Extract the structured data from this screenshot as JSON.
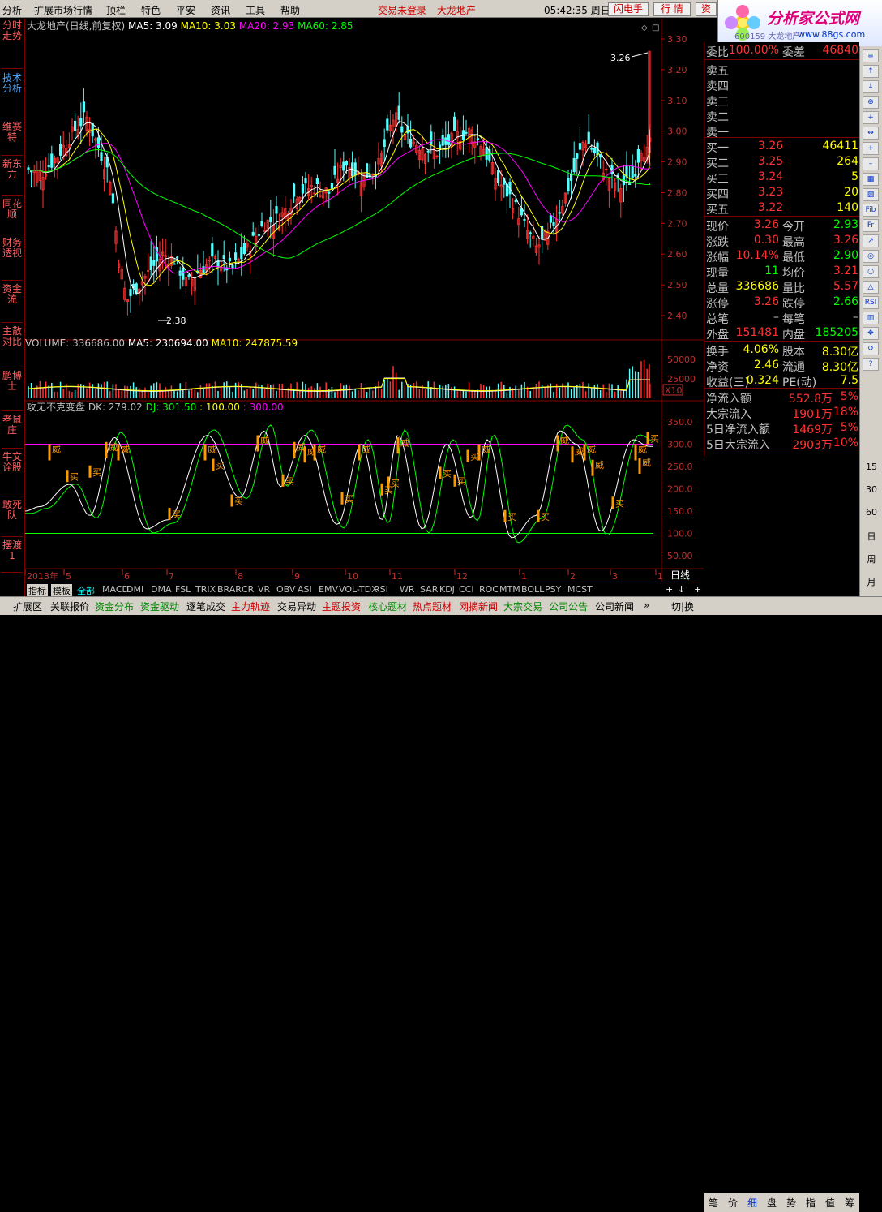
{
  "menu": {
    "items": [
      "分析",
      "扩展市场行情",
      "顶栏",
      "特色",
      "平安",
      "资讯",
      "工具",
      "帮助"
    ],
    "status_login": "交易未登录",
    "stock_name": "大龙地产",
    "clock": "05:42:35 周日",
    "btn_flash": "闪电手",
    "btn_quote": "行 情",
    "btn_zi": "资"
  },
  "logo": {
    "text": "分析家公式网",
    "url": "www.88gs.com",
    "code": "600159 大龙地产"
  },
  "leftbar": [
    "分时走势",
    "技术分析",
    "维赛特",
    "新东方",
    "同花顺",
    "财务透视",
    "资金流",
    "主散对比",
    "鹏博士",
    "老鼠庄",
    "牛文诠股",
    "敢死队",
    "摆渡1"
  ],
  "chart": {
    "title": "大龙地产(日线,前复权)",
    "ma5": "MA5: 3.09",
    "ma10": "MA10: 3.03",
    "ma20": "MA20: 2.93",
    "ma60": "MA60: 2.85",
    "price_ticks": [
      "3.30",
      "3.20",
      "3.10",
      "3.00",
      "2.90",
      "2.80",
      "2.70",
      "2.60",
      "2.50",
      "2.40"
    ],
    "high_label": "3.26",
    "low_label": "2.38",
    "vol_header": "VOLUME: 336686.00",
    "vol_ma5": "MA5: 230694.00",
    "vol_ma10": "MA10: 247875.59",
    "vol_ticks": [
      "50000",
      "25000"
    ],
    "vol_unit": "X10",
    "ind_title": "攻无不克变盘",
    "ind_dk": "DK: 279.02",
    "ind_dj": "DJ: 301.50",
    "ind_100": ": 100.00",
    "ind_300": ": 300.00",
    "ind_ticks": [
      "350.0",
      "300.0",
      "250.0",
      "200.0",
      "150.0",
      "100.0",
      "50.00"
    ],
    "sell_label": "威",
    "buy_label": "买",
    "date_labels": [
      "2013年",
      "5",
      "6",
      "7",
      "8",
      "9",
      "10",
      "11",
      "12",
      "1",
      "2",
      "3",
      "1"
    ],
    "period": "日线",
    "colors": {
      "up": "#ff3333",
      "down": "#54ffff",
      "ma5": "#ffffff",
      "ma10": "#ffff00",
      "ma20": "#ff00ff",
      "ma60": "#00ff00",
      "dk": "#ffffff",
      "dj": "#00ff00",
      "line300": "#ff00ff",
      "line100": "#00ff00",
      "signal": "#ff9900"
    }
  },
  "quote": {
    "weibi": {
      "l": "委比",
      "v": "100.00%",
      "l2": "委差",
      "v2": "46840"
    },
    "sell": [
      {
        "l": "卖五",
        "p": "",
        "v": ""
      },
      {
        "l": "卖四",
        "p": "",
        "v": ""
      },
      {
        "l": "卖三",
        "p": "",
        "v": ""
      },
      {
        "l": "卖二",
        "p": "",
        "v": ""
      },
      {
        "l": "卖一",
        "p": "",
        "v": ""
      }
    ],
    "buy": [
      {
        "l": "买一",
        "p": "3.26",
        "v": "46411"
      },
      {
        "l": "买二",
        "p": "3.25",
        "v": "264"
      },
      {
        "l": "买三",
        "p": "3.24",
        "v": "5"
      },
      {
        "l": "买四",
        "p": "3.23",
        "v": "20"
      },
      {
        "l": "买五",
        "p": "3.22",
        "v": "140"
      }
    ],
    "stats": [
      {
        "l": "现价",
        "v": "3.26",
        "vc": "#ff3333",
        "l2": "今开",
        "v2": "2.93",
        "v2c": "#00ff00"
      },
      {
        "l": "涨跌",
        "v": "0.30",
        "vc": "#ff3333",
        "l2": "最高",
        "v2": "3.26",
        "v2c": "#ff3333"
      },
      {
        "l": "涨幅",
        "v": "10.14%",
        "vc": "#ff3333",
        "l2": "最低",
        "v2": "2.90",
        "v2c": "#00ff00"
      },
      {
        "l": "现量",
        "v": "11",
        "vc": "#00ff00",
        "l2": "均价",
        "v2": "3.21",
        "v2c": "#ff3333"
      },
      {
        "l": "总量",
        "v": "336686",
        "vc": "#ffff00",
        "l2": "量比",
        "v2": "5.57",
        "v2c": "#ff3333"
      },
      {
        "l": "涨停",
        "v": "3.26",
        "vc": "#ff3333",
        "l2": "跌停",
        "v2": "2.66",
        "v2c": "#00ff00"
      },
      {
        "l": "总笔",
        "v": "–",
        "vc": "#c0c0c0",
        "l2": "每笔",
        "v2": "–",
        "v2c": "#c0c0c0"
      },
      {
        "l": "外盘",
        "v": "151481",
        "vc": "#ff3333",
        "l2": "内盘",
        "v2": "185205",
        "v2c": "#00ff00"
      }
    ],
    "stats2": [
      {
        "l": "换手",
        "v": "4.06%",
        "vc": "#ffff00",
        "l2": "股本",
        "v2": "8.30亿",
        "v2c": "#ffff00"
      },
      {
        "l": "净资",
        "v": "2.46",
        "vc": "#ffff00",
        "l2": "流通",
        "v2": "8.30亿",
        "v2c": "#ffff00"
      },
      {
        "l": "收益(三)",
        "v": "0.324",
        "vc": "#ffff00",
        "l2": "PE(动)",
        "v2": "7.5",
        "v2c": "#ffff00"
      }
    ],
    "flow": [
      {
        "l": "净流入额",
        "v": "552.8万",
        "p": "5%"
      },
      {
        "l": "大宗流入",
        "v": "1901万",
        "p": "18%"
      },
      {
        "l": "5日净流入额",
        "v": "1469万",
        "p": "5%"
      },
      {
        "l": "5日大宗流入",
        "v": "2903万",
        "p": "10%"
      }
    ]
  },
  "rightbar": {
    "nums": [
      "15",
      "30",
      "60",
      "日",
      "周",
      "月"
    ]
  },
  "bottomtabs": [
    "指标",
    "模板",
    "全部",
    "MACD",
    "DMI",
    "DMA",
    "FSL",
    "TRIX",
    "BRAR",
    "CR",
    "VR",
    "OBV",
    "ASI",
    "EMV",
    "VOL-TDX",
    "RSI",
    "WR",
    "SAR",
    "KDJ",
    "CCI",
    "ROC",
    "MTM",
    "BOLL",
    "PSY",
    "MCST"
  ],
  "statusbar": {
    "items": [
      "扩展区",
      "关联报价",
      "资金分布",
      "资金驱动",
      "逐笔成交",
      "主力轨迹",
      "交易异动",
      "主题投资",
      "核心题材",
      "热点题材",
      "网摘新闻",
      "大宗交易",
      "公司公告",
      "公司新闻"
    ],
    "right": [
      "笔",
      "价",
      "细",
      "盘",
      "势",
      "指",
      "值",
      "筹"
    ],
    "switch": "切|换"
  }
}
